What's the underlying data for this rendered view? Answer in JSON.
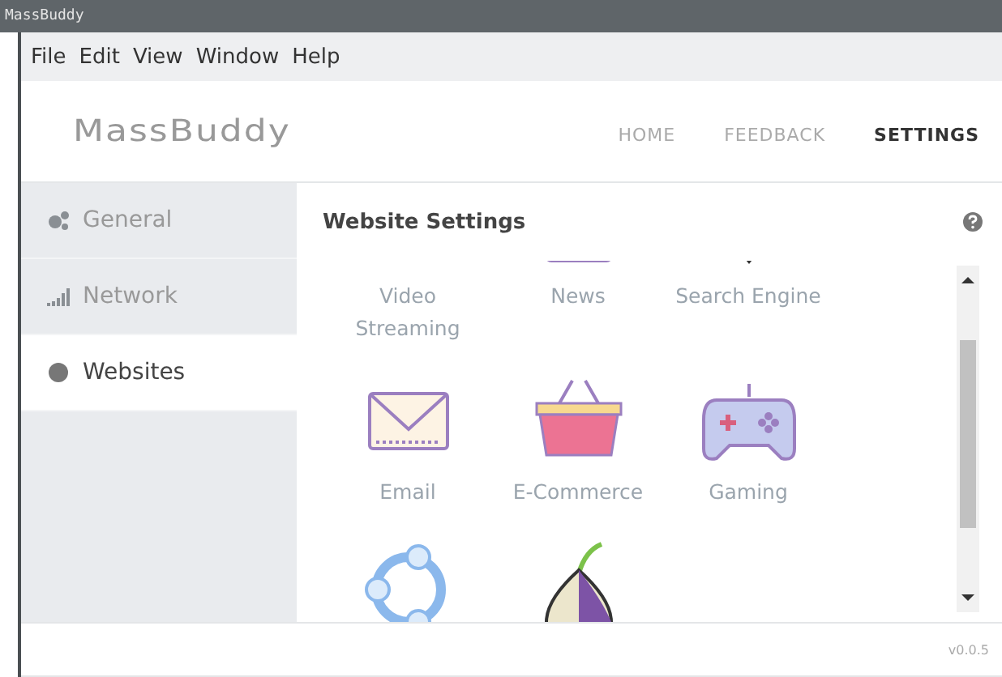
{
  "window": {
    "title": "MassBuddy"
  },
  "menu": [
    "File",
    "Edit",
    "View",
    "Window",
    "Help"
  ],
  "header": {
    "logo": "MassBuddy",
    "nav": [
      {
        "label": "HOME",
        "selected": false
      },
      {
        "label": "FEEDBACK",
        "selected": false
      },
      {
        "label": "SETTINGS",
        "selected": true
      }
    ]
  },
  "sidebar": {
    "items": [
      {
        "label": "General",
        "selected": false
      },
      {
        "label": "Network",
        "selected": false
      },
      {
        "label": "Websites",
        "selected": true
      }
    ]
  },
  "panel": {
    "title": "Website Settings",
    "tiles": [
      {
        "kind": "tile",
        "label": "Video Streaming"
      },
      {
        "kind": "tile",
        "label": "News"
      },
      {
        "kind": "tile",
        "label": "Search Engine"
      },
      {
        "kind": "tile",
        "label": "Email"
      },
      {
        "kind": "tile",
        "label": "E-Commerce"
      },
      {
        "kind": "tile",
        "label": "Gaming"
      },
      {
        "kind": "partial"
      },
      {
        "kind": "partial"
      }
    ]
  },
  "footer": {
    "version": "v0.0.5"
  }
}
